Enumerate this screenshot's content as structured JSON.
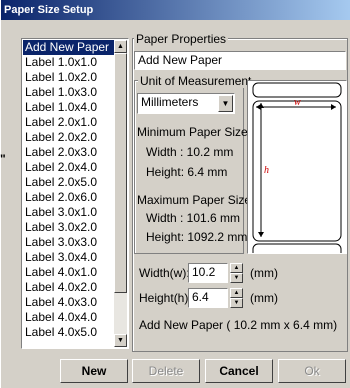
{
  "window": {
    "title": "Paper Size Setup"
  },
  "paper_list": {
    "items": [
      "Add New Paper",
      "Label 1.0x1.0",
      "Label 1.0x2.0",
      "Label 1.0x3.0",
      "Label 1.0x4.0",
      "Label 2.0x1.0",
      "Label 2.0x2.0",
      "Label 2.0x3.0",
      "Label 2.0x4.0",
      "Label 2.0x5.0",
      "Label 2.0x6.0",
      "Label 3.0x1.0",
      "Label 3.0x2.0",
      "Label 3.0x3.0",
      "Label 3.0x4.0",
      "Label 4.0x1.0",
      "Label 4.0x2.0",
      "Label 4.0x3.0",
      "Label 4.0x4.0",
      "Label 4.0x5.0"
    ],
    "selected_index": 0
  },
  "paper_properties": {
    "legend": "Paper Properties",
    "name_value": "Add New Paper"
  },
  "unit": {
    "legend": "Unit of Measurement",
    "selected": "Millimeters",
    "min_title": "Minimum Paper Sizes:",
    "min_width": "Width : 10.2 mm",
    "min_height": "Height: 6.4 mm",
    "max_title": "Maximum Paper Sizes:",
    "max_width": "Width : 101.6 mm",
    "max_height": "Height: 1092.2 mm"
  },
  "preview": {
    "w_label": "w",
    "h_label": "h"
  },
  "size": {
    "width_label": "Width(w):",
    "width_value": "10.2",
    "width_unit": "(mm)",
    "height_label": "Height(h):",
    "height_value": "6.4",
    "height_unit": "(mm)",
    "summary": "Add New Paper ( 10.2 mm x 6.4 mm)"
  },
  "buttons": {
    "new": "New",
    "delete": "Delete",
    "cancel": "Cancel",
    "ok": "Ok"
  },
  "stray_mark": "\""
}
